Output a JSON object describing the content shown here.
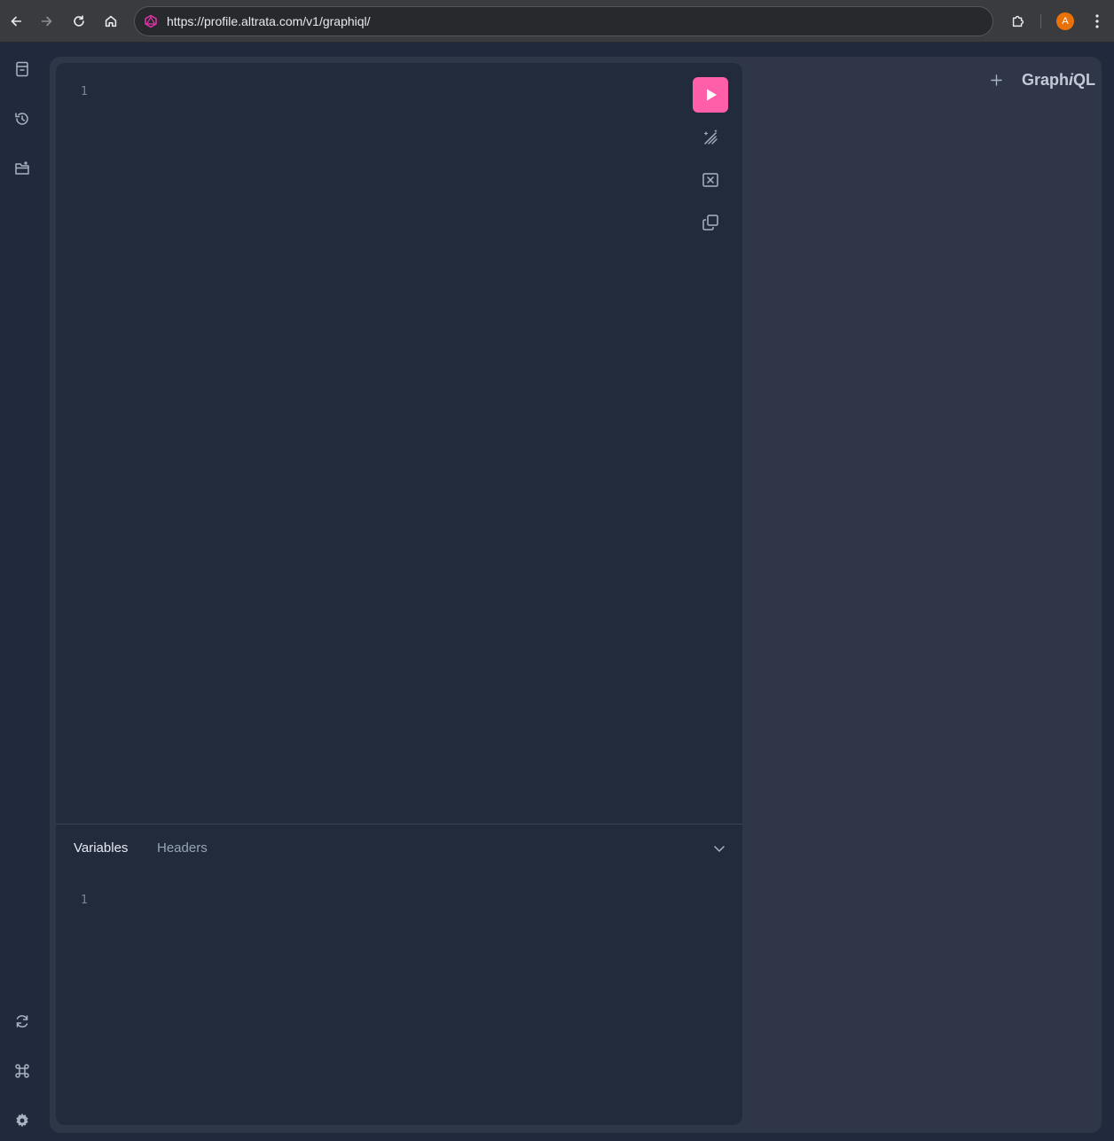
{
  "browser": {
    "url": "https://profile.altrata.com/v1/graphiql/",
    "profile_initial": "A"
  },
  "colors": {
    "accent": "#ff5fa8",
    "background": "#202a3c",
    "panel": "#222b3c",
    "sessions": "#2f3648"
  },
  "sidebar": {
    "top_icons": [
      "docs-icon",
      "history-icon",
      "explorer-folder-icon"
    ],
    "bottom_icons": [
      "refetch-schema-icon",
      "shortcuts-command-icon",
      "settings-gear-icon"
    ]
  },
  "editor": {
    "query_line_numbers": [
      "1"
    ],
    "toolbar": [
      "run-icon",
      "prettify-icon",
      "merge-fragments-icon",
      "copy-icon"
    ]
  },
  "bottom_panel": {
    "tabs": [
      {
        "label": "Variables",
        "active": true
      },
      {
        "label": "Headers",
        "active": false
      }
    ],
    "line_numbers": [
      "1"
    ]
  },
  "header": {
    "add_tab": "+",
    "logo_prefix": "Graph",
    "logo_i": "i",
    "logo_suffix": "QL"
  }
}
